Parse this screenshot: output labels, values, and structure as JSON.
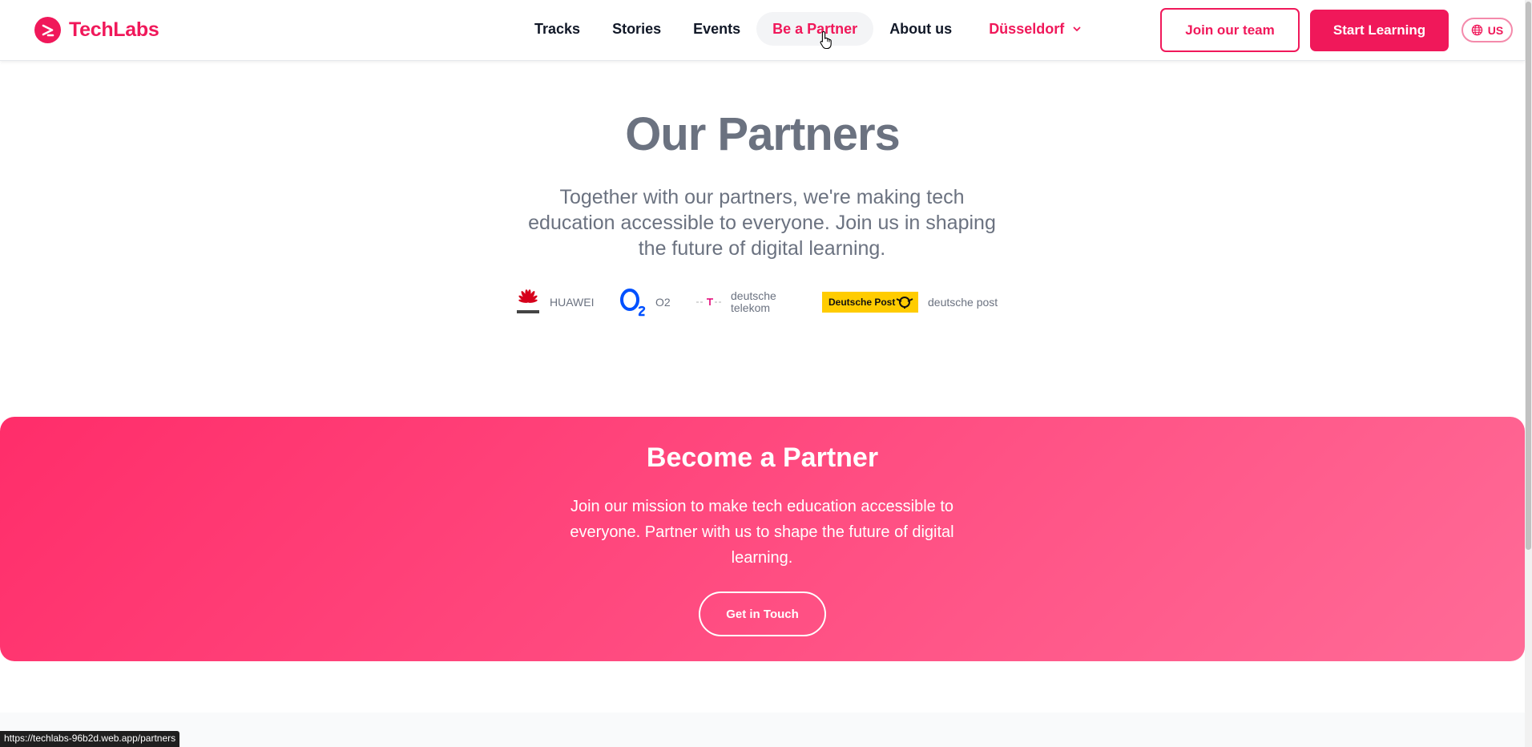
{
  "brand": {
    "name": "TechLabs",
    "color": "#f0185a"
  },
  "nav": {
    "links": [
      {
        "label": "Tracks"
      },
      {
        "label": "Stories"
      },
      {
        "label": "Events"
      },
      {
        "label": "Be a Partner",
        "active": true
      },
      {
        "label": "About us"
      }
    ],
    "city": "Düsseldorf",
    "join_label": "Join our team",
    "start_label": "Start Learning",
    "lang": "US"
  },
  "partners": {
    "title": "Our Partners",
    "subtitle": "Together with our partners, we're making tech education accessible to everyone. Join us in shaping the future of digital learning.",
    "logos": [
      {
        "name": "HUAWEI",
        "icon": "huawei-logo-icon"
      },
      {
        "name": "O2",
        "icon": "o2-logo-icon"
      },
      {
        "name_line1": "deutsche",
        "name_line2": "telekom",
        "icon": "telekom-logo-icon"
      },
      {
        "name": "deutsche post",
        "badge": "Deutsche Post",
        "icon": "deutsche-post-logo-icon"
      }
    ]
  },
  "become": {
    "title": "Become a Partner",
    "text": "Join our mission to make tech education accessible to everyone. Partner with us to shape the future of digital learning.",
    "cta": "Get in Touch"
  },
  "status_url": "https://techlabs-96b2d.web.app/partners"
}
